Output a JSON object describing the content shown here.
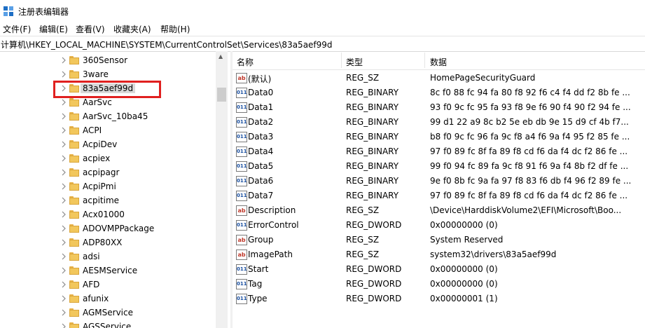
{
  "window": {
    "title": "注册表编辑器",
    "icon": "regedit-icon"
  },
  "menu": [
    "文件(F)",
    "编辑(E)",
    "查看(V)",
    "收藏夹(A)",
    "帮助(H)"
  ],
  "address": "计算机\\HKEY_LOCAL_MACHINE\\SYSTEM\\CurrentControlSet\\Services\\83a5aef99d",
  "tree": {
    "items": [
      {
        "label": "360Sensor"
      },
      {
        "label": "3ware"
      },
      {
        "label": "83a5aef99d",
        "selected": true
      },
      {
        "label": "AarSvc"
      },
      {
        "label": "AarSvc_10ba45"
      },
      {
        "label": "ACPI"
      },
      {
        "label": "AcpiDev"
      },
      {
        "label": "acpiex"
      },
      {
        "label": "acpipagr"
      },
      {
        "label": "AcpiPmi"
      },
      {
        "label": "acpitime"
      },
      {
        "label": "Acx01000"
      },
      {
        "label": "ADOVMPPackage"
      },
      {
        "label": "ADP80XX"
      },
      {
        "label": "adsi"
      },
      {
        "label": "AESMService"
      },
      {
        "label": "AFD"
      },
      {
        "label": "afunix"
      },
      {
        "label": "AGMService"
      },
      {
        "label": "AGSService"
      }
    ]
  },
  "columns": {
    "name": "名称",
    "type": "类型",
    "data": "数据"
  },
  "values": [
    {
      "name": "(默认)",
      "type": "REG_SZ",
      "data": "HomePageSecurityGuard",
      "icon": "sz"
    },
    {
      "name": "Data0",
      "type": "REG_BINARY",
      "data": "8c f0 88 fc 94 fa 80 f8 92 f6 c4 f4 dd f2 8b fe ...",
      "icon": "bin"
    },
    {
      "name": "Data1",
      "type": "REG_BINARY",
      "data": "93 f0 9c fc 95 fa 93 f8 9e f6 90 f4 90 f2 94 fe ...",
      "icon": "bin"
    },
    {
      "name": "Data2",
      "type": "REG_BINARY",
      "data": "99 d1 22 a9 8c b2 5e eb db 9e 15 d9 cf 4b f7...",
      "icon": "bin"
    },
    {
      "name": "Data3",
      "type": "REG_BINARY",
      "data": "b8 f0 9c fc 96 fa 9c f8 a4 f6 9a f4 95 f2 85 fe ...",
      "icon": "bin"
    },
    {
      "name": "Data4",
      "type": "REG_BINARY",
      "data": "97 f0 89 fc 8f fa 89 f8 cd f6 da f4 dc f2 86 fe ...",
      "icon": "bin"
    },
    {
      "name": "Data5",
      "type": "REG_BINARY",
      "data": "99 f0 94 fc 89 fa 9c f8 91 f6 9a f4 8b f2 df fe ...",
      "icon": "bin"
    },
    {
      "name": "Data6",
      "type": "REG_BINARY",
      "data": "9e f0 8b fc 9a fa 97 f8 83 f6 db f4 96 f2 89 fe ...",
      "icon": "bin"
    },
    {
      "name": "Data7",
      "type": "REG_BINARY",
      "data": "97 f0 89 fc 8f fa 89 f8 cd f6 da f4 dc f2 86 fe ...",
      "icon": "bin"
    },
    {
      "name": "Description",
      "type": "REG_SZ",
      "data": "\\Device\\HarddiskVolume2\\EFI\\Microsoft\\Boo...",
      "icon": "sz"
    },
    {
      "name": "ErrorControl",
      "type": "REG_DWORD",
      "data": "0x00000000 (0)",
      "icon": "bin"
    },
    {
      "name": "Group",
      "type": "REG_SZ",
      "data": "System Reserved",
      "icon": "sz"
    },
    {
      "name": "ImagePath",
      "type": "REG_SZ",
      "data": "system32\\drivers\\83a5aef99d",
      "icon": "sz"
    },
    {
      "name": "Start",
      "type": "REG_DWORD",
      "data": "0x00000000 (0)",
      "icon": "bin"
    },
    {
      "name": "Tag",
      "type": "REG_DWORD",
      "data": "0x00000000 (0)",
      "icon": "bin"
    },
    {
      "name": "Type",
      "type": "REG_DWORD",
      "data": "0x00000001 (1)",
      "icon": "bin"
    }
  ],
  "icons": {
    "sz": "ab",
    "bin": "011"
  },
  "colors": {
    "highlight": "#e0201f",
    "folder": "#f2c75c"
  }
}
